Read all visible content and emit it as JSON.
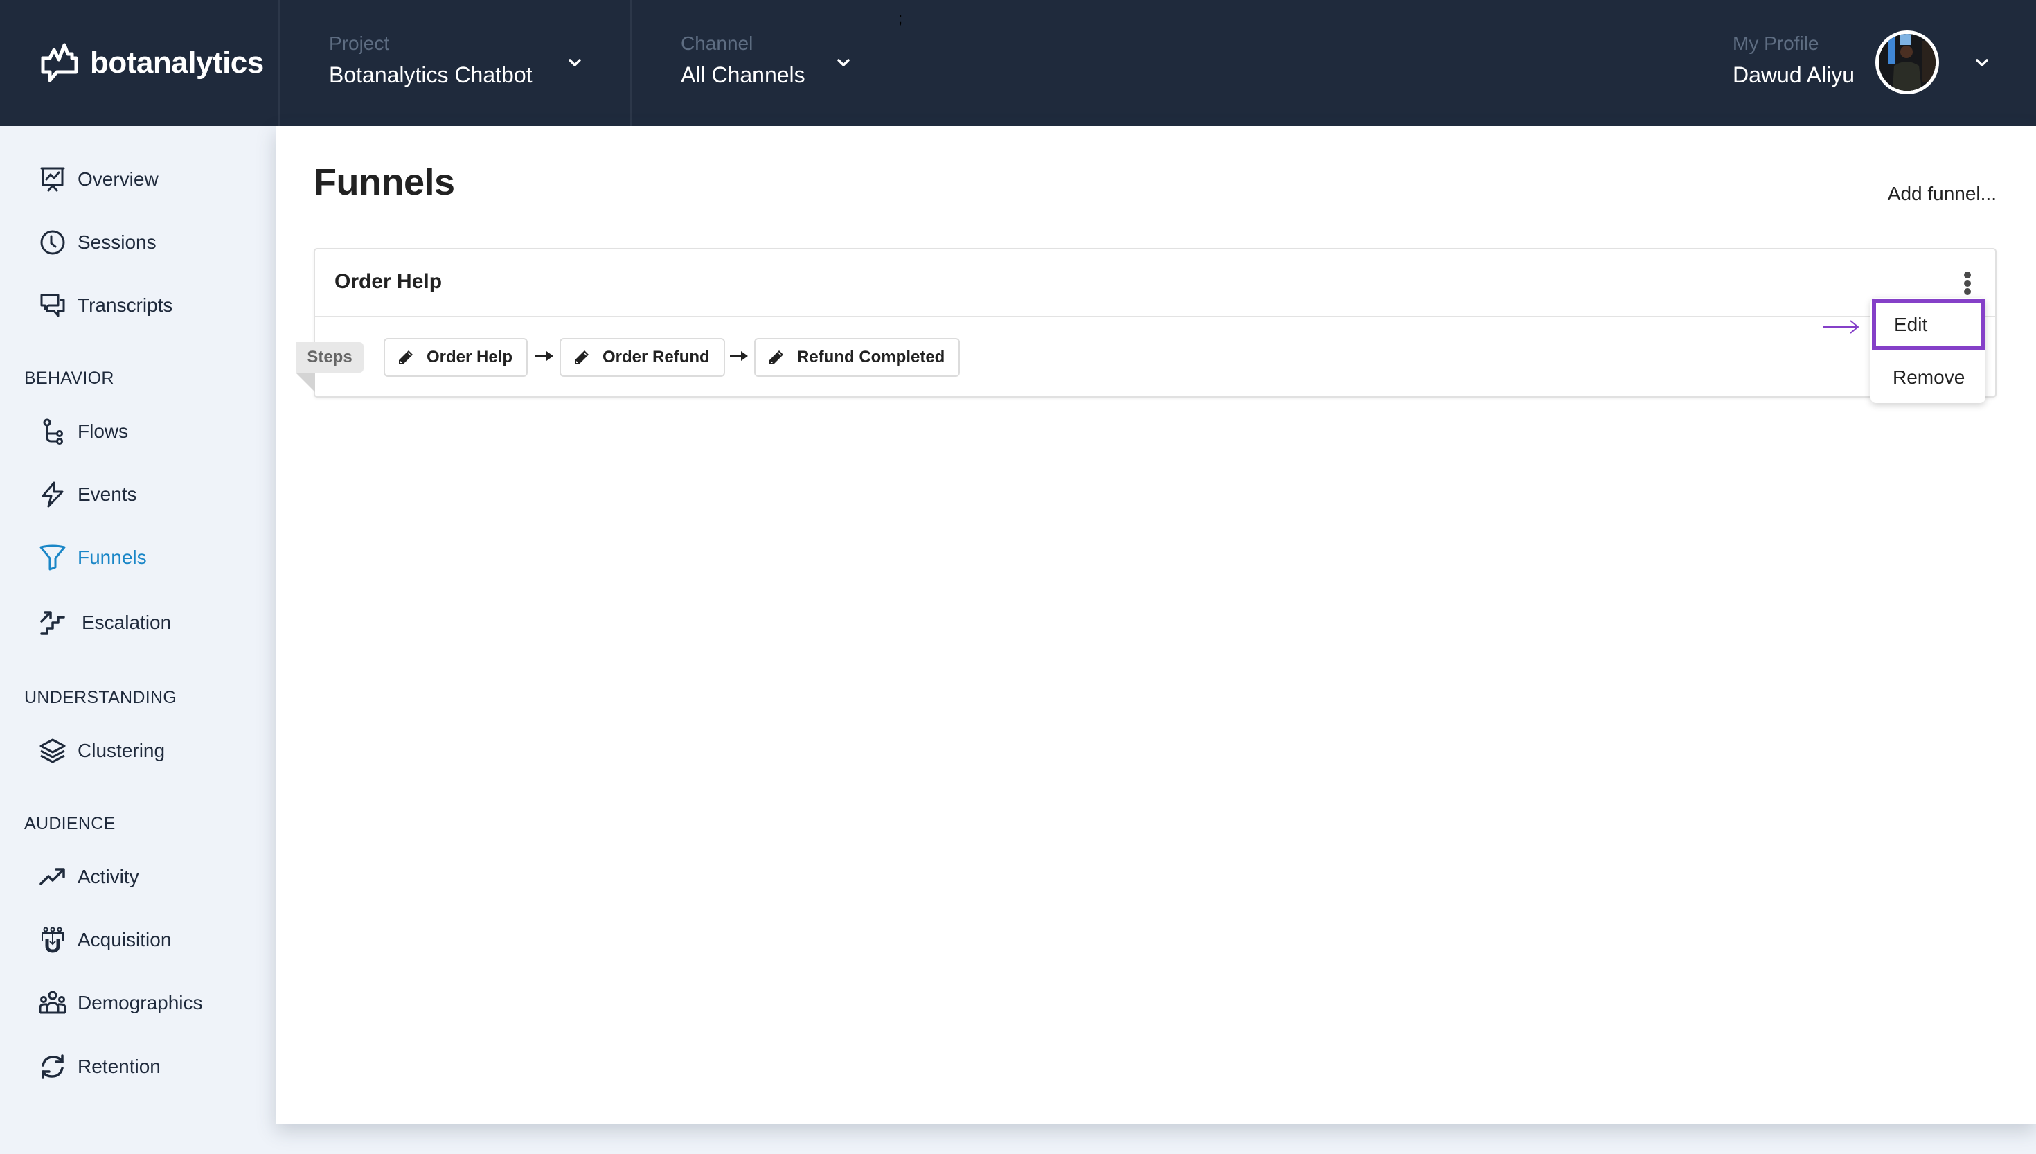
{
  "header": {
    "brand": "botanalytics",
    "project": {
      "label": "Project",
      "value": "Botanalytics Chatbot"
    },
    "channel": {
      "label": "Channel",
      "value": "All Channels"
    },
    "profile": {
      "label": "My Profile",
      "name": "Dawud Aliyu"
    },
    "stray_mark": ";"
  },
  "sidebar": {
    "items_top": [
      {
        "label": "Overview",
        "icon": "presentation-chart-icon"
      },
      {
        "label": "Sessions",
        "icon": "clock-icon"
      },
      {
        "label": "Transcripts",
        "icon": "chat-bubbles-icon"
      }
    ],
    "sections": [
      {
        "title": "BEHAVIOR",
        "items": [
          {
            "label": "Flows",
            "icon": "flow-branch-icon"
          },
          {
            "label": "Events",
            "icon": "lightning-icon"
          },
          {
            "label": "Funnels",
            "icon": "funnel-icon",
            "active": true
          },
          {
            "label": "Escalation",
            "icon": "stairs-arrow-icon"
          }
        ]
      },
      {
        "title": "UNDERSTANDING",
        "items": [
          {
            "label": "Clustering",
            "icon": "layers-icon"
          }
        ]
      },
      {
        "title": "AUDIENCE",
        "items": [
          {
            "label": "Activity",
            "icon": "trending-up-icon"
          },
          {
            "label": "Acquisition",
            "icon": "magnet-people-icon"
          },
          {
            "label": "Demographics",
            "icon": "group-icon"
          },
          {
            "label": "Retention",
            "icon": "refresh-icon"
          }
        ]
      }
    ]
  },
  "main": {
    "title": "Funnels",
    "add_funnel": "Add funnel...",
    "funnels": [
      {
        "name": "Order Help",
        "steps_label": "Steps",
        "steps": [
          "Order Help",
          "Order Refund",
          "Refund Completed"
        ]
      }
    ],
    "menu": {
      "items": [
        "Edit",
        "Remove"
      ],
      "highlighted": "Edit"
    }
  },
  "colors": {
    "header_bg": "#1f2a3c",
    "sidebar_bg": "#eff3f9",
    "active_nav": "#1a86c7",
    "highlight": "#8540c8"
  }
}
